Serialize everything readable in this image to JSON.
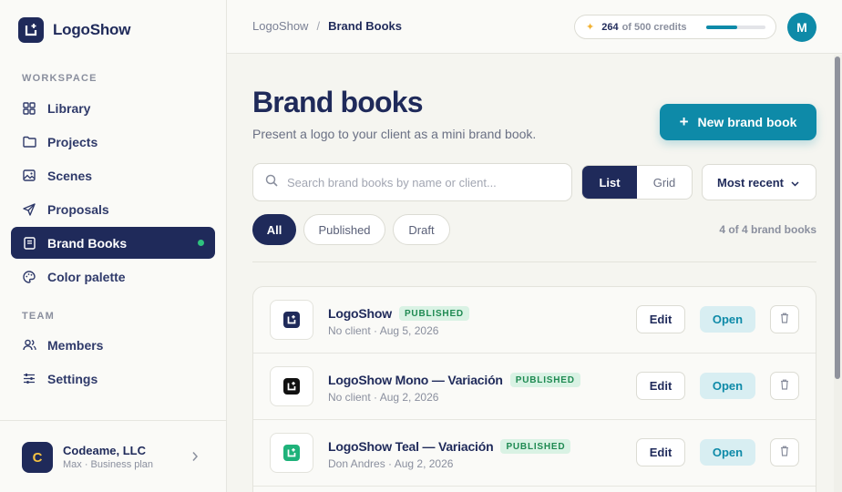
{
  "app": {
    "name": "LogoShow",
    "logo_icon": "logoshow-mark-icon",
    "brand_color": "#1f2a5a",
    "accent_color": "#0e8aa8"
  },
  "sidebar": {
    "workspace_label": "WORKSPACE",
    "team_label": "TEAM",
    "workspace_items": [
      {
        "label": "Library",
        "icon": "grid-icon"
      },
      {
        "label": "Projects",
        "icon": "folder-icon"
      },
      {
        "label": "Scenes",
        "icon": "image-icon"
      },
      {
        "label": "Proposals",
        "icon": "send-icon"
      },
      {
        "label": "Brand Books",
        "icon": "book-icon",
        "active": true
      },
      {
        "label": "Color palette",
        "icon": "palette-icon"
      }
    ],
    "team_items": [
      {
        "label": "Members",
        "icon": "users-icon"
      },
      {
        "label": "Settings",
        "icon": "sliders-icon"
      }
    ],
    "account": {
      "initial": "C",
      "name": "Codeame, LLC",
      "plan": "Max · Business plan"
    }
  },
  "topbar": {
    "breadcrumb": [
      "LogoShow",
      "Brand Books"
    ],
    "breadcrumb_sep": "/",
    "credits": {
      "used": "264",
      "of_text": "of 500 credits",
      "fraction": 0.528
    },
    "user_initial": "M"
  },
  "main": {
    "title": "Brand books",
    "subtitle": "Present a logo to your client as a mini brand book.",
    "new_button": "New brand book",
    "search_placeholder": "Search brand books by name or client...",
    "view_toggle": {
      "list": "List",
      "grid": "Grid",
      "selected": "List"
    },
    "sort_label": "Most recent",
    "filters": [
      "All",
      "Published",
      "Draft"
    ],
    "selected_filter": "All",
    "count_text": "4 of 4 brand books",
    "rows": [
      {
        "title": "LogoShow",
        "status": "PUBLISHED",
        "meta": "No client · Aug 5, 2026",
        "mark_color": "#1f2a5a",
        "edit": "Edit",
        "open": "Open"
      },
      {
        "title": "LogoShow Mono — Variación",
        "status": "PUBLISHED",
        "meta": "No client · Aug 2, 2026",
        "mark_color": "#111111",
        "edit": "Edit",
        "open": "Open"
      },
      {
        "title": "LogoShow Teal — Variación",
        "status": "PUBLISHED",
        "meta": "Don Andres · Aug 2, 2026",
        "mark_color": "#1fb27a",
        "edit": "Edit",
        "open": "Open"
      }
    ]
  }
}
